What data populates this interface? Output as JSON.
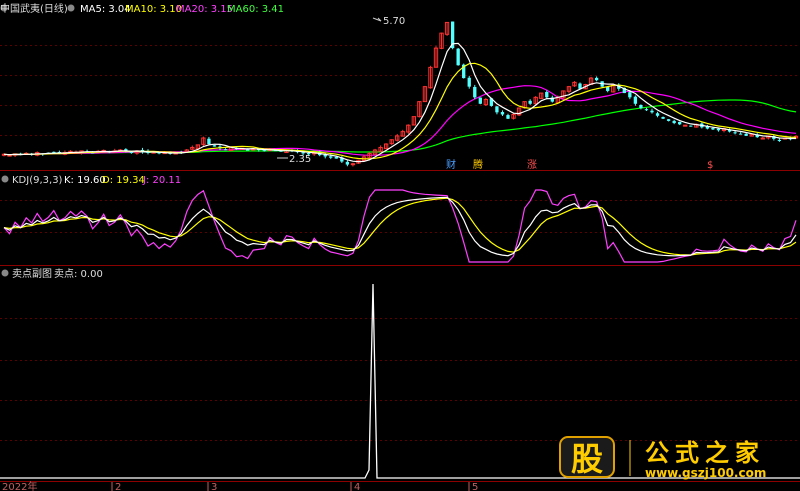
{
  "price_panel": {
    "stock_name": "中国武夷(日线)",
    "ma5_text": "MA5: 3.04",
    "ma10_text": "MA10: 3.10",
    "ma20_text": "MA20: 3.15",
    "ma60_text": "MA60: 3.41",
    "high_label": "5.70",
    "low_label": "2.35",
    "markers": [
      "财",
      "腾",
      "涨",
      "$"
    ],
    "colors": {
      "ma5": "#ffffff",
      "ma10": "#ffff00",
      "ma20": "#ff00ff",
      "ma60": "#00ff00",
      "up": "#ff3232",
      "down": "#54ffff"
    }
  },
  "kdj_panel": {
    "name": "KDJ(9,3,3)",
    "k_text": "K: 19.60",
    "d_text": "D: 19.34",
    "j_text": "J: 20.11"
  },
  "sell_panel": {
    "name": "卖点副图",
    "value_text": "卖点: 0.00"
  },
  "x_axis": {
    "ticks": [
      "2022年",
      "2",
      "3",
      "4",
      "5"
    ]
  },
  "watermark": {
    "char": "股",
    "title": "公式之家",
    "url": "www.gszj100.com"
  },
  "chart_data": [
    {
      "type": "candlestick",
      "title": "中国武夷(日线)",
      "annotations": {
        "high": 5.7,
        "low": 2.35
      },
      "series": [
        {
          "name": "MA5",
          "value": 3.04
        },
        {
          "name": "MA10",
          "value": 3.1
        },
        {
          "name": "MA20",
          "value": 3.15
        },
        {
          "name": "MA60",
          "value": 3.41
        }
      ],
      "close": [
        2.62,
        2.6,
        2.63,
        2.61,
        2.64,
        2.62,
        2.66,
        2.63,
        2.65,
        2.67,
        2.64,
        2.66,
        2.69,
        2.67,
        2.7,
        2.68,
        2.66,
        2.69,
        2.71,
        2.68,
        2.7,
        2.72,
        2.69,
        2.67,
        2.7,
        2.68,
        2.65,
        2.67,
        2.64,
        2.66,
        2.63,
        2.65,
        2.67,
        2.72,
        2.78,
        2.84,
        3.0,
        2.86,
        2.8,
        2.76,
        2.72,
        2.78,
        2.74,
        2.76,
        2.73,
        2.75,
        2.72,
        2.7,
        2.73,
        2.7,
        2.68,
        2.71,
        2.69,
        2.67,
        2.64,
        2.62,
        2.66,
        2.6,
        2.57,
        2.54,
        2.52,
        2.45,
        2.38,
        2.4,
        2.48,
        2.56,
        2.64,
        2.72,
        2.78,
        2.86,
        2.96,
        3.05,
        3.15,
        3.3,
        3.5,
        3.85,
        4.2,
        4.65,
        5.1,
        5.45,
        5.7,
        5.1,
        4.7,
        4.4,
        4.2,
        3.95,
        3.8,
        3.9,
        3.75,
        3.6,
        3.55,
        3.45,
        3.55,
        3.7,
        3.85,
        3.8,
        3.95,
        4.05,
        3.95,
        3.85,
        3.95,
        4.1,
        4.2,
        4.3,
        4.15,
        4.25,
        4.4,
        4.35,
        4.2,
        4.1,
        4.25,
        4.15,
        4.05,
        3.95,
        3.8,
        3.7,
        3.65,
        3.6,
        3.52,
        3.45,
        3.4,
        3.35,
        3.32,
        3.3,
        3.28,
        3.32,
        3.25,
        3.22,
        3.2,
        3.18,
        3.22,
        3.15,
        3.12,
        3.1,
        3.05,
        3.08,
        3.02,
        3.0,
        3.05,
        2.98,
        2.95,
        3.0,
        2.98,
        3.04
      ]
    },
    {
      "type": "line",
      "title": "KDJ(9,3,3)",
      "series": [
        {
          "name": "K",
          "value": 19.6
        },
        {
          "name": "D",
          "value": 19.34
        },
        {
          "name": "J",
          "value": 20.11
        }
      ]
    },
    {
      "type": "line",
      "title": "卖点副图",
      "series": [
        {
          "name": "卖点",
          "value": 0.0
        }
      ],
      "spike": {
        "position": "April",
        "value": "peak"
      }
    }
  ]
}
